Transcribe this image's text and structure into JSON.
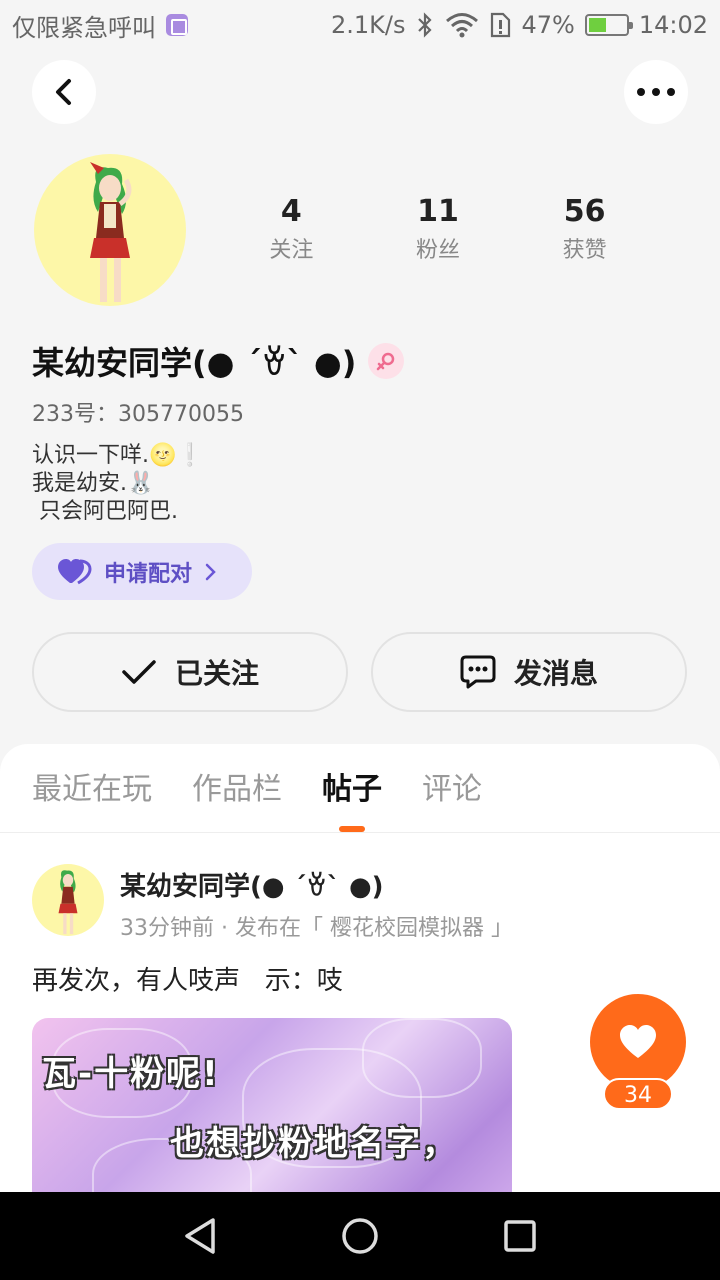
{
  "status_bar": {
    "left_text": "仅限紧急呼叫",
    "net_speed": "2.1K/s",
    "battery_percent": "47%",
    "battery_level": 0.47,
    "time": "14:02",
    "icons": [
      "gallery-icon",
      "bluetooth-icon",
      "wifi-icon",
      "sim-alert-icon",
      "battery-icon"
    ]
  },
  "header": {
    "back_icon": "chevron-left-icon",
    "more_icon": "more-dots-icon"
  },
  "profile": {
    "stats": [
      {
        "value": "4",
        "label": "关注"
      },
      {
        "value": "11",
        "label": "粉丝"
      },
      {
        "value": "56",
        "label": "获赞"
      }
    ],
    "name": "某幼安同学(● ´ꈊ` ●)",
    "id_line": "233号：305770055",
    "bio_lines": [
      "认识一下咩.🌝❕",
      "我是幼安.🐰",
      " 只会阿巴阿巴."
    ],
    "pair_label": "申请配对",
    "follow_label": "已关注",
    "message_label": "发消息",
    "colors": {
      "accent": "#ff6a1a",
      "pair_bg": "#e6e2fa",
      "pair_text": "#5e4fc4"
    }
  },
  "tabs": [
    {
      "label": "最近在玩",
      "active": false
    },
    {
      "label": "作品栏",
      "active": false
    },
    {
      "label": "帖子",
      "active": true
    },
    {
      "label": "评论",
      "active": false
    }
  ],
  "post": {
    "author": "某幼安同学(● ´ꈊ` ●)",
    "meta": "33分钟前 · 发布在「 樱花校园模拟器 」",
    "text": "再发次，有人吱声   示：吱",
    "image_lines": [
      "瓦-十粉呢!",
      "也想抄粉地名字，"
    ],
    "likes": "34"
  },
  "nav_bar": {
    "icons": [
      "back-triangle-icon",
      "home-circle-icon",
      "recents-square-icon"
    ]
  }
}
